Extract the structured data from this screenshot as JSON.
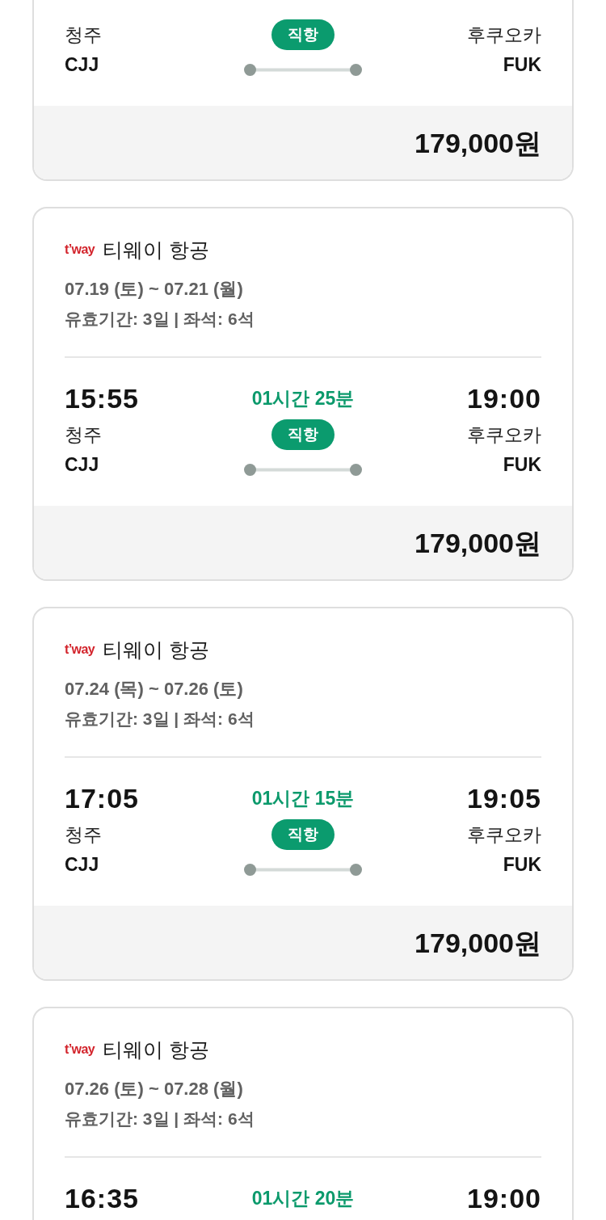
{
  "cards": [
    {
      "departure": {
        "city": "청주",
        "code": "CJJ"
      },
      "flight_type": "직항",
      "arrival": {
        "city": "후쿠오카",
        "code": "FUK"
      },
      "price": "179,000원"
    },
    {
      "airline": {
        "logo": "t’way",
        "name": "티웨이 항공"
      },
      "dates": "07.19 (토) ~ 07.21 (월)",
      "validity": "유효기간: 3일 | 좌석: 6석",
      "departure": {
        "time": "15:55",
        "city": "청주",
        "code": "CJJ"
      },
      "duration": "01시간 25분",
      "flight_type": "직항",
      "arrival": {
        "time": "19:00",
        "city": "후쿠오카",
        "code": "FUK"
      },
      "price": "179,000원"
    },
    {
      "airline": {
        "logo": "t’way",
        "name": "티웨이 항공"
      },
      "dates": "07.24 (목) ~ 07.26 (토)",
      "validity": "유효기간: 3일 | 좌석: 6석",
      "departure": {
        "time": "17:05",
        "city": "청주",
        "code": "CJJ"
      },
      "duration": "01시간 15분",
      "flight_type": "직항",
      "arrival": {
        "time": "19:05",
        "city": "후쿠오카",
        "code": "FUK"
      },
      "price": "179,000원"
    },
    {
      "airline": {
        "logo": "t’way",
        "name": "티웨이 항공"
      },
      "dates": "07.26 (토) ~ 07.28 (월)",
      "validity": "유효기간: 3일 | 좌석: 6석",
      "departure": {
        "time": "16:35"
      },
      "duration": "01시간 20분",
      "arrival": {
        "time": "19:00"
      }
    }
  ]
}
